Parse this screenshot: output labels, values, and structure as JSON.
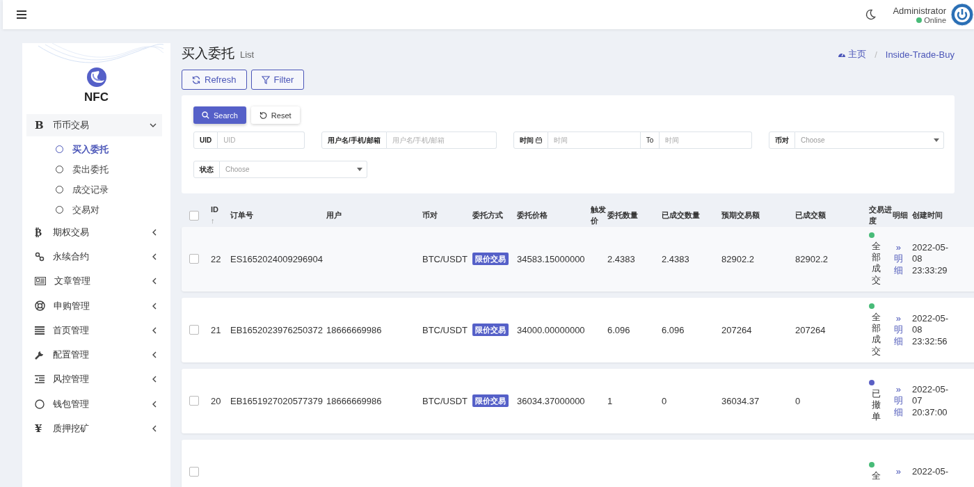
{
  "topbar": {
    "user": {
      "name": "Administrator",
      "status": "Online",
      "color": "#48bb78"
    }
  },
  "sidebar": {
    "logo_text": "NFC",
    "items": [
      {
        "glyph": "B",
        "label": "币币交易",
        "expanded": true,
        "children": [
          {
            "label": "买入委托",
            "selected": true
          },
          {
            "label": "卖出委托",
            "selected": false
          },
          {
            "label": "成交记录",
            "selected": false
          },
          {
            "label": "交易对",
            "selected": false
          }
        ]
      },
      {
        "glyph": "₿",
        "label": "期权交易",
        "expanded": false
      },
      {
        "label": "永续合约",
        "expanded": false
      },
      {
        "label": "文章管理",
        "expanded": false
      },
      {
        "label": "申购管理",
        "expanded": false
      },
      {
        "label": "首页管理",
        "expanded": false
      },
      {
        "label": "配置管理",
        "expanded": false
      },
      {
        "label": "风控管理",
        "expanded": false
      },
      {
        "label": "钱包管理",
        "expanded": false
      },
      {
        "glyph": "¥",
        "label": "质押挖矿",
        "expanded": false
      }
    ]
  },
  "page": {
    "title": "买入委托",
    "subtitle": "List",
    "breadcrumb": [
      {
        "label": "主页",
        "kind": "home"
      },
      {
        "label": "Inside-Trade-Buy",
        "kind": "page"
      }
    ],
    "breadcrumb_separator": "/"
  },
  "toolbar": [
    "Refresh",
    "Filter"
  ],
  "filter": {
    "buttons": [
      {
        "label": "Search",
        "kind": "primary"
      },
      {
        "label": "Reset",
        "kind": "plain"
      }
    ],
    "fields": [
      {
        "kind": "text",
        "label": "UID",
        "placeholder": "UID"
      },
      {
        "kind": "text",
        "label": "用户名/手机/邮箱",
        "placeholder": "用户名/手机/邮箱"
      },
      {
        "kind": "daterange",
        "label": "时间",
        "placeholder": "时间",
        "separator": "To",
        "placeholder_end": "时间"
      },
      {
        "kind": "select",
        "label": "币对",
        "placeholder": "Choose"
      },
      {
        "kind": "select",
        "label": "状态",
        "placeholder": "Choose"
      }
    ]
  },
  "table": {
    "header_checked": false,
    "columns": [
      "ID",
      "订单号",
      "用户",
      "币对",
      "委托方式",
      "委托价格",
      "触发价",
      "委托数量",
      "已成交数量",
      "预期交易额",
      "已成交额",
      "交易进度",
      "明细",
      "创建时间"
    ],
    "sort_icon": "↑",
    "rows": [
      {
        "checked": false,
        "id": "22",
        "order_no": "ES1652024009296904",
        "pair": "BTC/USDT",
        "type": "限价交易",
        "price": "34583.15000000",
        "quantity": "2.4383",
        "filled_qty": "2.4383",
        "expected": "82902.2",
        "filled_amount": "82902.2",
        "status": "全部成交",
        "color": "#48bb78",
        "detail_icon": "»",
        "detail": "明细",
        "created": "2022-05-08 23:33:29"
      },
      {
        "checked": false,
        "id": "21",
        "order_no": "EB1652023976250372",
        "user": "18666669986",
        "pair": "BTC/USDT",
        "type": "限价交易",
        "price": "34000.00000000",
        "quantity": "6.096",
        "filled_qty": "6.096",
        "expected": "207264",
        "filled_amount": "207264",
        "status": "全部成交",
        "color": "#48bb78",
        "detail_icon": "»",
        "detail": "明细",
        "created": "2022-05-08 23:32:56"
      },
      {
        "checked": false,
        "id": "20",
        "order_no": "EB1651927020577379",
        "user": "18666669986",
        "pair": "BTC/USDT",
        "type": "限价交易",
        "price": "36034.37000000",
        "quantity": "1",
        "filled_qty": "0",
        "expected": "36034.37",
        "filled_amount": "0",
        "status": "已撤单",
        "color": "#5a5fc4",
        "detail_icon": "»",
        "detail": "明细",
        "created": "2022-05-07 20:37:00"
      },
      {
        "checked": false,
        "status": "全",
        "color": "#48bb78",
        "detail_icon": "»",
        "created": "2022-05-"
      }
    ]
  }
}
